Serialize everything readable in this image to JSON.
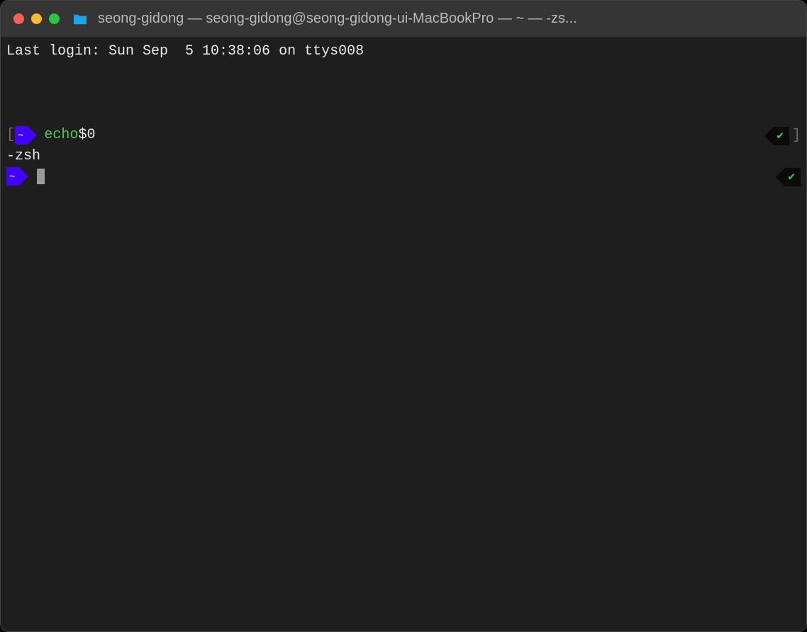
{
  "titlebar": {
    "title": "seong-gidong — seong-gidong@seong-gidong-ui-MacBookPro — ~ — -zs..."
  },
  "terminal": {
    "last_login": "Last login: Sun Sep  5 10:38:06 on ttys008",
    "prompt_dir": "~",
    "lines": [
      {
        "command_green": "echo",
        "command_white": " $0",
        "status": "ok"
      }
    ],
    "output": "-zsh",
    "current_prompt_dir": "~",
    "status_check": "✔"
  },
  "colors": {
    "prompt_bg": "#4200ff",
    "success": "#4ec94e",
    "terminal_bg": "#1e1e1e",
    "titlebar_bg": "#353535"
  }
}
